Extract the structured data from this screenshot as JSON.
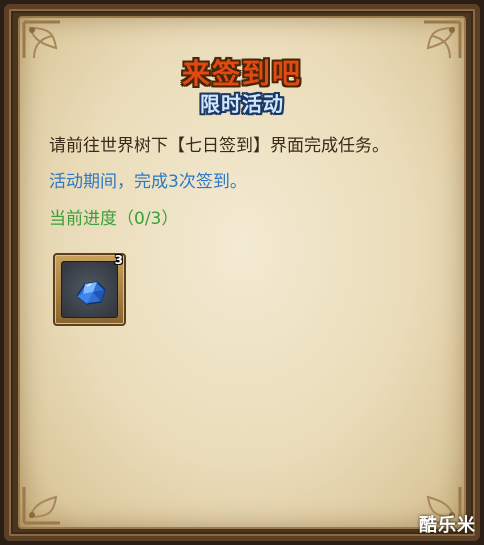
{
  "panel": {
    "title": "来签到吧",
    "subtitle": "限时活动",
    "description": "请前往世界树下【七日签到】界面完成任务。",
    "period": "活动期间，完成3次签到。",
    "progress": "当前进度（0/3）"
  },
  "reward": {
    "icon": "blue-crystal-icon",
    "count": "3"
  },
  "watermark": "酷乐米",
  "colors": {
    "title": "#e24a12",
    "subtitle": "#cfe6ff",
    "period_text": "#2a78c6",
    "progress_text": "#38a03a",
    "parchment": "#eadcb9"
  }
}
